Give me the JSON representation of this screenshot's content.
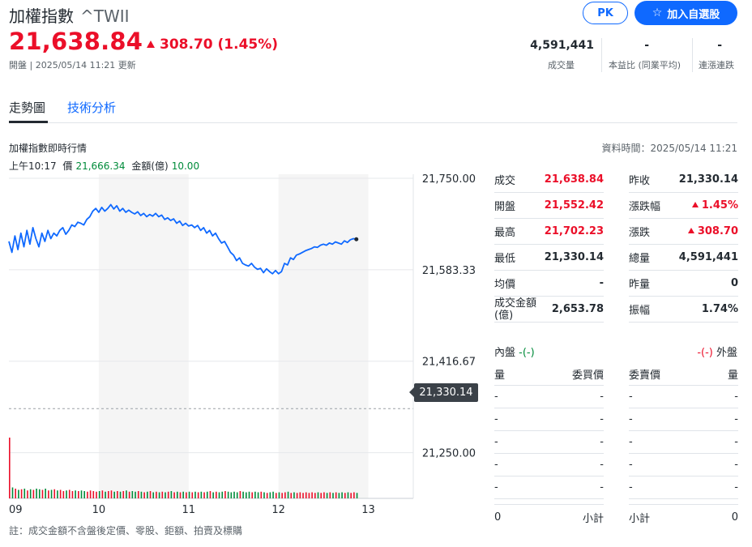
{
  "header": {
    "name": "加權指數",
    "symbol": "^TWII",
    "price": "21,638.84",
    "change": "308.70 (1.45%)",
    "status": "開盤 | 2025/05/14 11:21 更新",
    "pk_label": "PK",
    "add_label": "加入自選股"
  },
  "quote_stats": [
    {
      "value": "4,591,441",
      "label": "成交量"
    },
    {
      "value": "-",
      "label": "本益比 (同業平均)"
    },
    {
      "value": "-",
      "label": "連漲連跌"
    }
  ],
  "tabs": [
    {
      "label": "走勢圖",
      "active": true
    },
    {
      "label": "技術分析",
      "active": false
    }
  ],
  "section": {
    "title": "加權指數即時行情",
    "data_time": "資料時間：2025/05/14 11:21"
  },
  "tooltip": {
    "time": "上午10:17",
    "price_label": "價",
    "price": "21,666.34",
    "amount_label": "金額(億)",
    "amount": "10.00"
  },
  "chart_data": {
    "type": "line",
    "title": "",
    "x_ticks": [
      "09",
      "10",
      "11",
      "12",
      "13"
    ],
    "y_ticks": [
      "21,750.00",
      "21,583.33",
      "21,416.67",
      "21,250.00"
    ],
    "ylim": [
      21166.67,
      21750.0
    ],
    "xlim_minutes": [
      0,
      270
    ],
    "previous_close": 21330.14,
    "previous_close_label": "21,330.14",
    "price_series": [
      [
        0,
        21635
      ],
      [
        2,
        21615
      ],
      [
        4,
        21645
      ],
      [
        6,
        21620
      ],
      [
        8,
        21650
      ],
      [
        10,
        21625
      ],
      [
        12,
        21655
      ],
      [
        14,
        21630
      ],
      [
        16,
        21660
      ],
      [
        18,
        21640
      ],
      [
        20,
        21625
      ],
      [
        22,
        21650
      ],
      [
        24,
        21635
      ],
      [
        26,
        21655
      ],
      [
        28,
        21640
      ],
      [
        30,
        21650
      ],
      [
        32,
        21645
      ],
      [
        34,
        21655
      ],
      [
        36,
        21660
      ],
      [
        38,
        21648
      ],
      [
        40,
        21655
      ],
      [
        42,
        21665
      ],
      [
        44,
        21662
      ],
      [
        46,
        21670
      ],
      [
        48,
        21668
      ],
      [
        50,
        21665
      ],
      [
        52,
        21675
      ],
      [
        54,
        21680
      ],
      [
        56,
        21690
      ],
      [
        58,
        21695
      ],
      [
        60,
        21688
      ],
      [
        62,
        21697
      ],
      [
        64,
        21690
      ],
      [
        66,
        21695
      ],
      [
        68,
        21702
      ],
      [
        70,
        21694
      ],
      [
        72,
        21700
      ],
      [
        74,
        21690
      ],
      [
        76,
        21695
      ],
      [
        78,
        21688
      ],
      [
        80,
        21692
      ],
      [
        82,
        21688
      ],
      [
        84,
        21685
      ],
      [
        86,
        21689
      ],
      [
        88,
        21682
      ],
      [
        90,
        21686
      ],
      [
        92,
        21680
      ],
      [
        94,
        21684
      ],
      [
        96,
        21681
      ],
      [
        98,
        21686
      ],
      [
        100,
        21680
      ],
      [
        102,
        21683
      ],
      [
        104,
        21675
      ],
      [
        106,
        21678
      ],
      [
        108,
        21673
      ],
      [
        110,
        21676
      ],
      [
        112,
        21668
      ],
      [
        114,
        21672
      ],
      [
        116,
        21664
      ],
      [
        118,
        21668
      ],
      [
        120,
        21663
      ],
      [
        122,
        21665
      ],
      [
        124,
        21660
      ],
      [
        126,
        21664
      ],
      [
        128,
        21655
      ],
      [
        130,
        21660
      ],
      [
        132,
        21650
      ],
      [
        134,
        21655
      ],
      [
        136,
        21645
      ],
      [
        138,
        21650
      ],
      [
        140,
        21640
      ],
      [
        142,
        21632
      ],
      [
        144,
        21635
      ],
      [
        146,
        21625
      ],
      [
        148,
        21615
      ],
      [
        150,
        21610
      ],
      [
        152,
        21600
      ],
      [
        154,
        21605
      ],
      [
        156,
        21595
      ],
      [
        158,
        21592
      ],
      [
        160,
        21590
      ],
      [
        162,
        21595
      ],
      [
        164,
        21588
      ],
      [
        166,
        21584
      ],
      [
        168,
        21586
      ],
      [
        170,
        21578
      ],
      [
        172,
        21585
      ],
      [
        174,
        21580
      ],
      [
        176,
        21576
      ],
      [
        178,
        21582
      ],
      [
        180,
        21576
      ],
      [
        182,
        21580
      ],
      [
        184,
        21595
      ],
      [
        186,
        21592
      ],
      [
        188,
        21605
      ],
      [
        190,
        21602
      ],
      [
        192,
        21610
      ],
      [
        194,
        21612
      ],
      [
        196,
        21615
      ],
      [
        198,
        21618
      ],
      [
        200,
        21620
      ],
      [
        202,
        21622
      ],
      [
        204,
        21625
      ],
      [
        206,
        21624
      ],
      [
        208,
        21628
      ],
      [
        210,
        21630
      ],
      [
        212,
        21628
      ],
      [
        214,
        21632
      ],
      [
        216,
        21630
      ],
      [
        218,
        21634
      ],
      [
        220,
        21632
      ],
      [
        222,
        21630
      ],
      [
        224,
        21636
      ],
      [
        226,
        21633
      ],
      [
        228,
        21638
      ],
      [
        230,
        21640
      ],
      [
        232,
        21638.84
      ]
    ],
    "volume_series": [
      [
        0,
        10.0
      ],
      [
        2,
        1.8
      ],
      [
        4,
        1.6
      ],
      [
        6,
        1.4
      ],
      [
        8,
        1.5
      ],
      [
        10,
        1.6
      ],
      [
        12,
        1.3
      ],
      [
        14,
        1.5
      ],
      [
        16,
        1.4
      ],
      [
        18,
        1.6
      ],
      [
        20,
        1.5
      ],
      [
        22,
        1.4
      ],
      [
        24,
        1.6
      ],
      [
        26,
        1.3
      ],
      [
        28,
        1.4
      ],
      [
        30,
        1.5
      ],
      [
        32,
        1.3
      ],
      [
        34,
        1.4
      ],
      [
        36,
        1.2
      ],
      [
        38,
        1.3
      ],
      [
        40,
        1.4
      ],
      [
        42,
        1.2
      ],
      [
        44,
        1.3
      ],
      [
        46,
        1.2
      ],
      [
        48,
        1.3
      ],
      [
        50,
        1.2
      ],
      [
        52,
        1.1
      ],
      [
        54,
        1.3
      ],
      [
        56,
        1.2
      ],
      [
        58,
        1.1
      ],
      [
        60,
        1.2
      ],
      [
        62,
        1.3
      ],
      [
        64,
        1.1
      ],
      [
        66,
        1.2
      ],
      [
        68,
        1.3
      ],
      [
        70,
        1.1
      ],
      [
        72,
        1.2
      ],
      [
        74,
        1.1
      ],
      [
        76,
        1.2
      ],
      [
        78,
        1.3
      ],
      [
        80,
        1.1
      ],
      [
        82,
        1.2
      ],
      [
        84,
        1.1
      ],
      [
        86,
        1.2
      ],
      [
        88,
        1.1
      ],
      [
        90,
        1.0
      ],
      [
        92,
        1.1
      ],
      [
        94,
        1.2
      ],
      [
        96,
        1.0
      ],
      [
        98,
        1.1
      ],
      [
        100,
        1.0
      ],
      [
        102,
        1.1
      ],
      [
        104,
        1.0
      ],
      [
        106,
        1.1
      ],
      [
        108,
        1.2
      ],
      [
        110,
        1.0
      ],
      [
        112,
        1.1
      ],
      [
        114,
        1.0
      ],
      [
        116,
        1.1
      ],
      [
        118,
        1.0
      ],
      [
        120,
        1.1
      ],
      [
        122,
        1.0
      ],
      [
        124,
        1.1
      ],
      [
        126,
        1.0
      ],
      [
        128,
        1.1
      ],
      [
        130,
        1.0
      ],
      [
        132,
        1.1
      ],
      [
        134,
        1.2
      ],
      [
        136,
        1.0
      ],
      [
        138,
        1.1
      ],
      [
        140,
        1.0
      ],
      [
        142,
        1.1
      ],
      [
        144,
        1.2
      ],
      [
        146,
        1.1
      ],
      [
        148,
        1.0
      ],
      [
        150,
        1.1
      ],
      [
        152,
        1.0
      ],
      [
        154,
        1.2
      ],
      [
        156,
        1.1
      ],
      [
        158,
        1.0
      ],
      [
        160,
        1.1
      ],
      [
        162,
        1.0
      ],
      [
        164,
        1.1
      ],
      [
        166,
        1.0
      ],
      [
        168,
        1.1
      ],
      [
        170,
        1.0
      ],
      [
        172,
        0.9
      ],
      [
        174,
        1.0
      ],
      [
        176,
        1.1
      ],
      [
        178,
        0.9
      ],
      [
        180,
        1.0
      ],
      [
        182,
        0.9
      ],
      [
        184,
        1.0
      ],
      [
        186,
        1.1
      ],
      [
        188,
        0.9
      ],
      [
        190,
        1.0
      ],
      [
        192,
        0.9
      ],
      [
        194,
        1.0
      ],
      [
        196,
        0.9
      ],
      [
        198,
        1.0
      ],
      [
        200,
        0.9
      ],
      [
        202,
        1.0
      ],
      [
        204,
        0.9
      ],
      [
        206,
        1.0
      ],
      [
        208,
        0.9
      ],
      [
        210,
        1.0
      ],
      [
        212,
        0.9
      ],
      [
        214,
        1.0
      ],
      [
        216,
        0.9
      ],
      [
        218,
        1.0
      ],
      [
        220,
        0.9
      ],
      [
        222,
        1.0
      ],
      [
        224,
        0.9
      ],
      [
        226,
        1.0
      ],
      [
        228,
        0.9
      ],
      [
        230,
        1.0
      ],
      [
        232,
        0.9
      ]
    ],
    "volume_max": 10.0,
    "colors": {
      "line": "#0f69ff",
      "up": "#eb0f29",
      "down": "#008b3a",
      "band": "#f5f5f5"
    }
  },
  "stats_left": [
    {
      "label": "成交",
      "value": "21,638.84",
      "color": "red"
    },
    {
      "label": "開盤",
      "value": "21,552.42",
      "color": "red"
    },
    {
      "label": "最高",
      "value": "21,702.23",
      "color": "red"
    },
    {
      "label": "最低",
      "value": "21,330.14",
      "color": ""
    },
    {
      "label": "均價",
      "value": "-",
      "color": ""
    },
    {
      "label": "成交金額(億)",
      "value": "2,653.78",
      "color": ""
    }
  ],
  "stats_right": [
    {
      "label": "昨收",
      "value": "21,330.14",
      "color": ""
    },
    {
      "label": "漲跌幅",
      "value": "1.45%",
      "color": "red",
      "arrow": true
    },
    {
      "label": "漲跌",
      "value": "308.70",
      "color": "red",
      "arrow": true
    },
    {
      "label": "總量",
      "value": "4,591,441",
      "color": ""
    },
    {
      "label": "昨量",
      "value": "0",
      "color": ""
    },
    {
      "label": "振幅",
      "value": "1.74%",
      "color": ""
    }
  ],
  "bidask": {
    "inner_label": "內盤",
    "inner_value": "-(-)",
    "outer_label": "外盤",
    "outer_value": "-(-)",
    "bid_headers": [
      "量",
      "委買價"
    ],
    "ask_headers": [
      "委賣價",
      "量"
    ],
    "bid_rows": [
      [
        "-",
        "-"
      ],
      [
        "-",
        "-"
      ],
      [
        "-",
        "-"
      ],
      [
        "-",
        "-"
      ],
      [
        "-",
        "-"
      ]
    ],
    "ask_rows": [
      [
        "-",
        "-"
      ],
      [
        "-",
        "-"
      ],
      [
        "-",
        "-"
      ],
      [
        "-",
        "-"
      ],
      [
        "-",
        "-"
      ]
    ],
    "bid_total": [
      "0",
      "小計"
    ],
    "ask_total": [
      "小計",
      "0"
    ]
  },
  "note": "註：成交金額不含盤後定價、零股、鉅額、拍賣及標購"
}
